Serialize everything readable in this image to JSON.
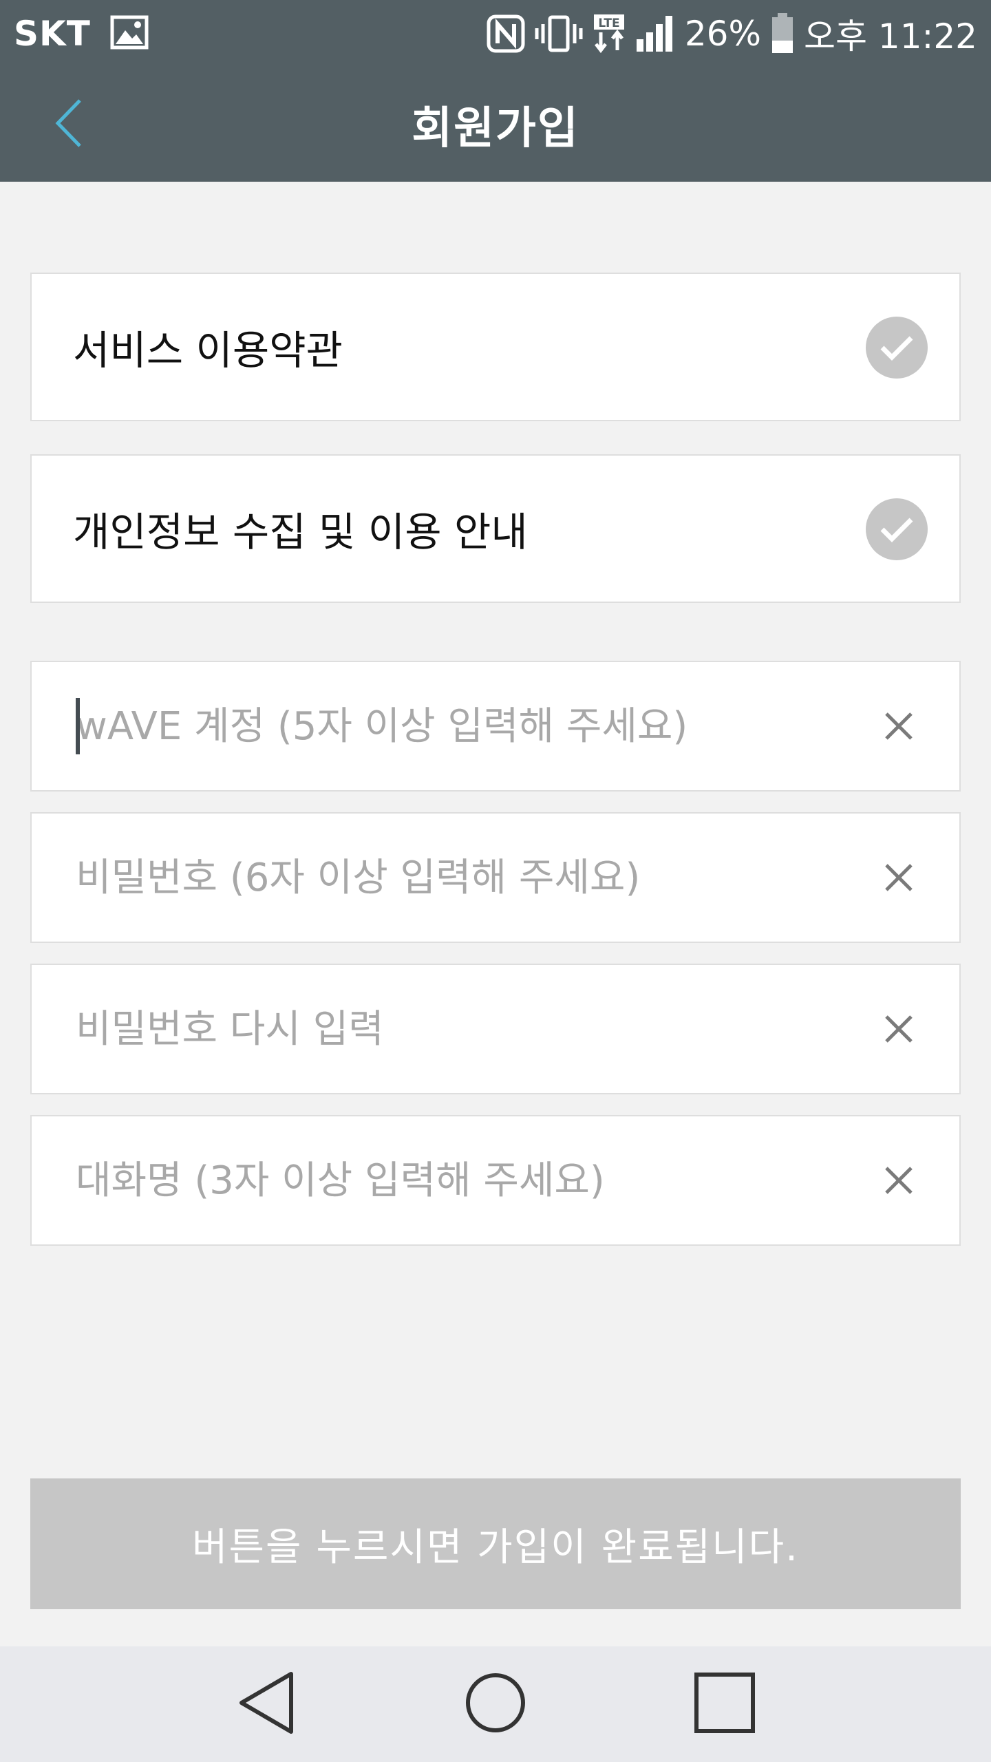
{
  "status_bar": {
    "carrier": "SKT",
    "battery_percent": "26%",
    "time": "오후 11:22"
  },
  "header": {
    "title": "회원가입"
  },
  "agreements": [
    {
      "label": "서비스 이용약관",
      "checked": true
    },
    {
      "label": "개인정보 수집 및 이용 안내",
      "checked": true
    }
  ],
  "fields": {
    "account": {
      "value": "",
      "placeholder": "wAVE 계정 (5자 이상 입력해 주세요)"
    },
    "password": {
      "value": "",
      "placeholder": "비밀번호 (6자 이상 입력해 주세요)"
    },
    "password_confirm": {
      "value": "",
      "placeholder": "비밀번호 다시 입력"
    },
    "nickname": {
      "value": "",
      "placeholder": "대화명 (3자 이상 입력해 주세요)"
    }
  },
  "submit": {
    "label": "버튼을 누르시면 가입이 완료됩니다."
  },
  "colors": {
    "header_bg": "#535f64",
    "accent": "#4fb6d6",
    "check_bg": "#c6c6c6",
    "button_disabled": "#c6c6c6"
  },
  "icons": [
    "image-icon",
    "nfc-icon",
    "vibrate-icon",
    "lte-icon",
    "signal-icon",
    "battery-icon",
    "back-arrow-icon",
    "check-icon",
    "clear-icon",
    "nav-back-icon",
    "nav-home-icon",
    "nav-recents-icon"
  ]
}
